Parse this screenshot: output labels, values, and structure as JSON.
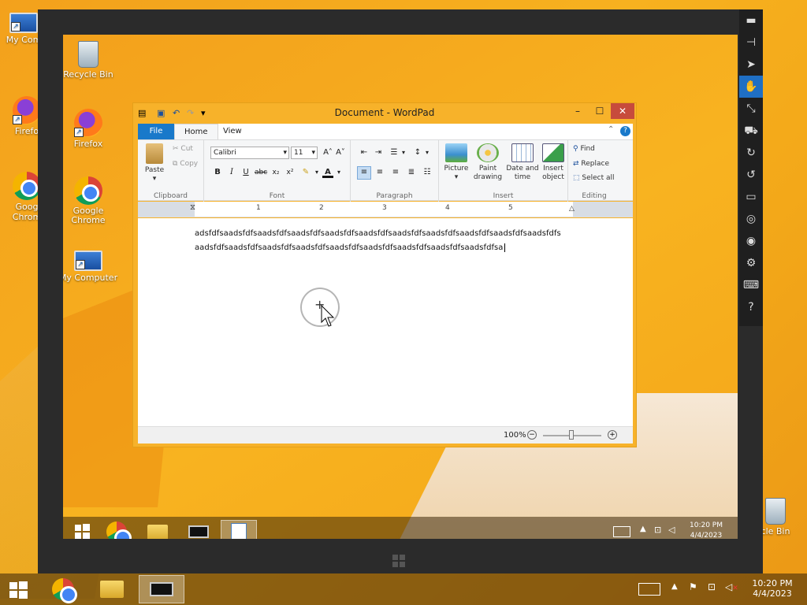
{
  "host_desktop": {
    "icons": [
      "My Com",
      "Firefo",
      "Goog\nChrom",
      "cle Bin"
    ]
  },
  "vm_desktop": {
    "icons": [
      "Recycle Bin",
      "Firefox",
      "Google Chrome",
      "My Computer"
    ]
  },
  "side_toolbar": {
    "buttons": [
      "minimize-icon",
      "pin-icon",
      "pointer-icon",
      "hand-icon",
      "scale-icon",
      "car-icon",
      "refresh-icon",
      "rotate-icon",
      "monitor-icon",
      "globe-icon",
      "camera-icon",
      "gear-icon",
      "keyboard-icon",
      "help-icon"
    ],
    "active": "hand-icon"
  },
  "wordpad": {
    "title": "Document - WordPad",
    "tabs": {
      "file": "File",
      "home": "Home",
      "view": "View"
    },
    "clipboard": {
      "paste": "Paste",
      "cut": "Cut",
      "copy": "Copy",
      "label": "Clipboard"
    },
    "font": {
      "family": "Calibri",
      "size": "11",
      "label": "Font"
    },
    "paragraph": {
      "label": "Paragraph"
    },
    "insert": {
      "picture": "Picture",
      "paint1": "Paint",
      "paint2": "drawing",
      "date1": "Date and",
      "date2": "time",
      "obj1": "Insert",
      "obj2": "object",
      "label": "Insert"
    },
    "editing": {
      "find": "Find",
      "replace": "Replace",
      "select_all": "Select all",
      "label": "Editing"
    },
    "ruler_numbers": [
      "1",
      "2",
      "3",
      "4",
      "5"
    ],
    "document_lines": [
      "adsfdfsaadsfdfsaadsfdfsaadsfdfsaadsfdfsaadsfdfsaadsfdfsaadsfdfsaadsfdfsaadsfdfsaadsfdfs",
      "aadsfdfsaadsfdfsaadsfdfsaadsfdfsaadsfdfsaadsfdfsaadsfdfsaadsfdfsaadsfdfsa"
    ],
    "zoom": "100%"
  },
  "vm_taskbar": {
    "time": "10:20 PM",
    "date": "4/4/2023"
  },
  "host_taskbar": {
    "time": "10:20 PM",
    "date": "4/4/2023"
  }
}
